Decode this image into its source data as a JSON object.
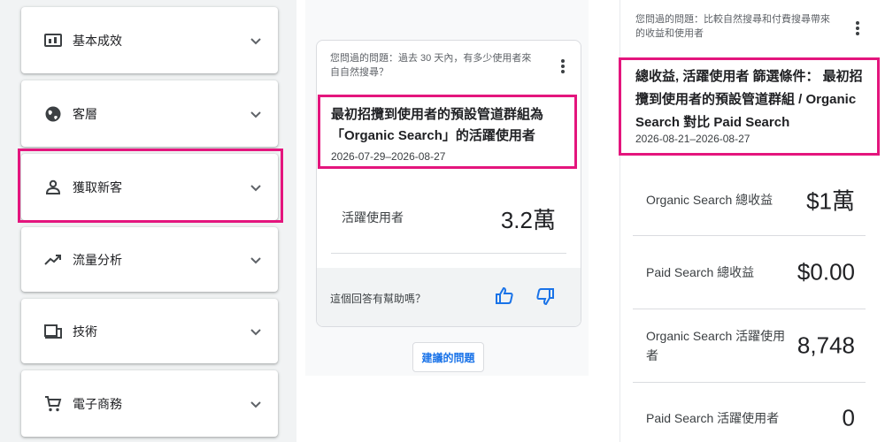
{
  "nav": {
    "items": [
      {
        "label": "基本成效",
        "icon": "reports-snapshot-icon"
      },
      {
        "label": "客層",
        "icon": "globe-icon"
      },
      {
        "label": "獲取新客",
        "icon": "person-icon"
      },
      {
        "label": "流量分析",
        "icon": "trending-up-icon"
      },
      {
        "label": "技術",
        "icon": "devices-icon"
      },
      {
        "label": "電子商務",
        "icon": "shopping-cart-icon"
      }
    ]
  },
  "middle": {
    "question": "您問過的問題：過去 30 天內，有多少使用者來自自然搜尋？",
    "title": "最初招攬到使用者的預設管道群組為「Organic Search」的活躍使用者",
    "date_range": "2026-07-29–2026-08-27",
    "metric_label": "活躍使用者",
    "metric_value": "3.2萬",
    "feedback_prompt": "這個回答有幫助嗎？",
    "suggest_button": "建議的問題"
  },
  "right": {
    "question": "您問過的問題：比較自然搜尋和付費搜尋帶來的收益和使用者",
    "title": "總收益, 活躍使用者 篩選條件： 最初招攬到使用者的預設管道群組 / Organic Search 對比 Paid Search",
    "date_range": "2026-08-21–2026-08-27",
    "metrics": [
      {
        "label": "Organic Search 總收益",
        "value": "$1萬"
      },
      {
        "label": "Paid Search 總收益",
        "value": "$0.00"
      },
      {
        "label": "Organic Search 活躍使用者",
        "value": "8,748"
      },
      {
        "label": "Paid Search 活躍使用者",
        "value": "0"
      }
    ]
  },
  "colors": {
    "highlight": "#e4157d",
    "accent_blue": "#1a73e8"
  }
}
